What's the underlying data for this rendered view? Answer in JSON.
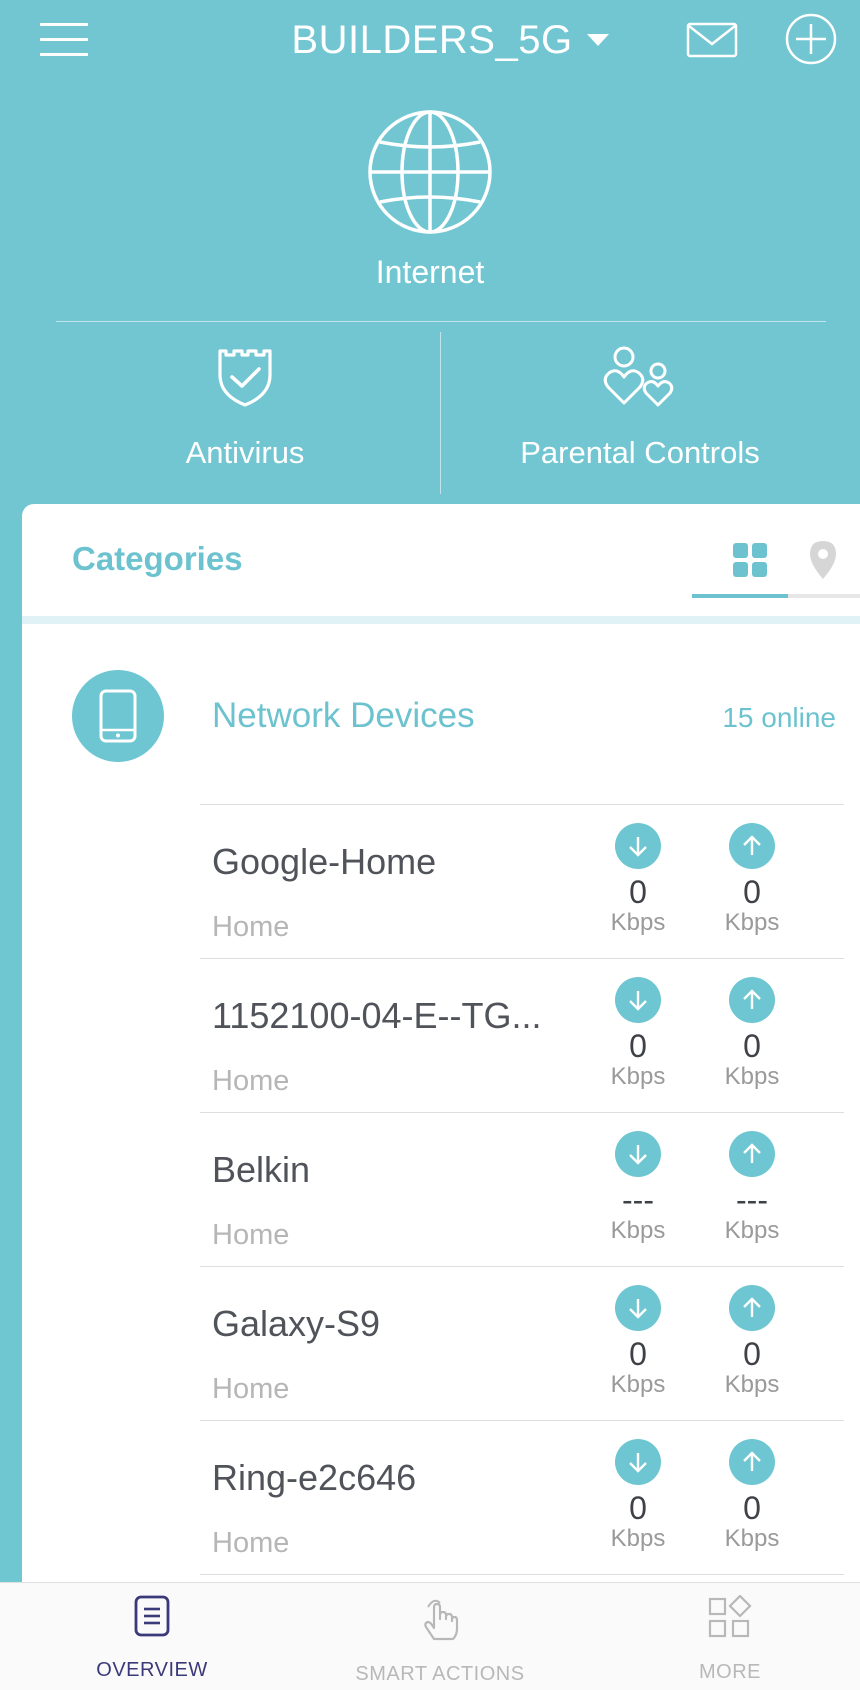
{
  "header": {
    "network_name": "BUILDERS_5G",
    "internet_label": "Internet",
    "features": [
      {
        "label": "Antivirus",
        "icon": "shield-check-icon"
      },
      {
        "label": "Parental Controls",
        "icon": "family-hearts-icon"
      }
    ],
    "icons": [
      "menu-icon",
      "mail-icon",
      "plus-circle-icon",
      "globe-icon",
      "caret-down-icon"
    ]
  },
  "categories": {
    "title": "Categories",
    "active_tab": "grid",
    "tabs": [
      {
        "icon": "grid-icon"
      },
      {
        "icon": "map-pin-icon"
      }
    ]
  },
  "network_devices": {
    "title": "Network Devices",
    "count_label": "15 online",
    "devices": [
      {
        "name": "Google-Home",
        "group": "Home",
        "down": "0",
        "up": "0",
        "unit": "Kbps"
      },
      {
        "name": "1152100-04-E--TG...",
        "group": "Home",
        "down": "0",
        "up": "0",
        "unit": "Kbps"
      },
      {
        "name": "Belkin",
        "group": "Home",
        "down": "---",
        "up": "---",
        "unit": "Kbps"
      },
      {
        "name": "Galaxy-S9",
        "group": "Home",
        "down": "0",
        "up": "0",
        "unit": "Kbps"
      },
      {
        "name": "Ring-e2c646",
        "group": "Home",
        "down": "0",
        "up": "0",
        "unit": "Kbps"
      }
    ]
  },
  "bottom_nav": {
    "active": "overview",
    "items": [
      {
        "label": "OVERVIEW",
        "icon": "document-list-icon"
      },
      {
        "label": "SMART ACTIONS",
        "icon": "tap-hand-icon"
      },
      {
        "label": "MORE",
        "icon": "apps-grid-icon"
      }
    ]
  },
  "colors": {
    "brand": "#71c6d2",
    "accent_text": "#6cc3cf",
    "nav_active": "#3a3a7a"
  }
}
